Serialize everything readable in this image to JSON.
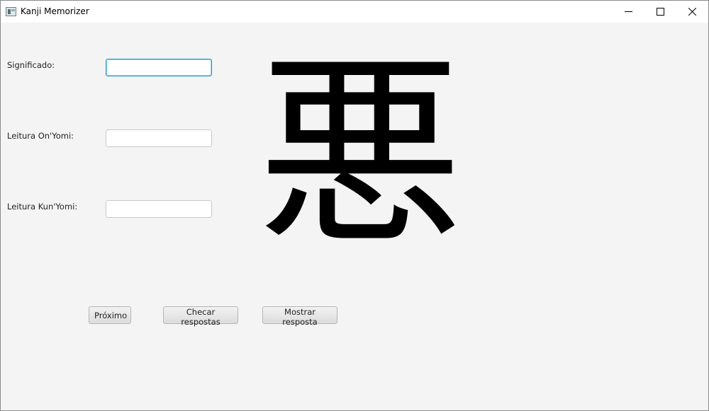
{
  "window": {
    "title": "Kanji Memorizer",
    "icon": "app-icon",
    "controls": [
      "minimize-icon",
      "maximize-icon",
      "close-icon"
    ]
  },
  "form": {
    "meaning_label": "Significado:",
    "meaning_value": "",
    "onyomi_label": "Leitura On'Yomi:",
    "onyomi_value": "",
    "kunyomi_label": "Leitura Kun'Yomi:",
    "kunyomi_value": ""
  },
  "kanji": {
    "character": "悪"
  },
  "buttons": {
    "next": "Próximo",
    "check": "Checar respostas",
    "show": "Mostrar resposta"
  }
}
